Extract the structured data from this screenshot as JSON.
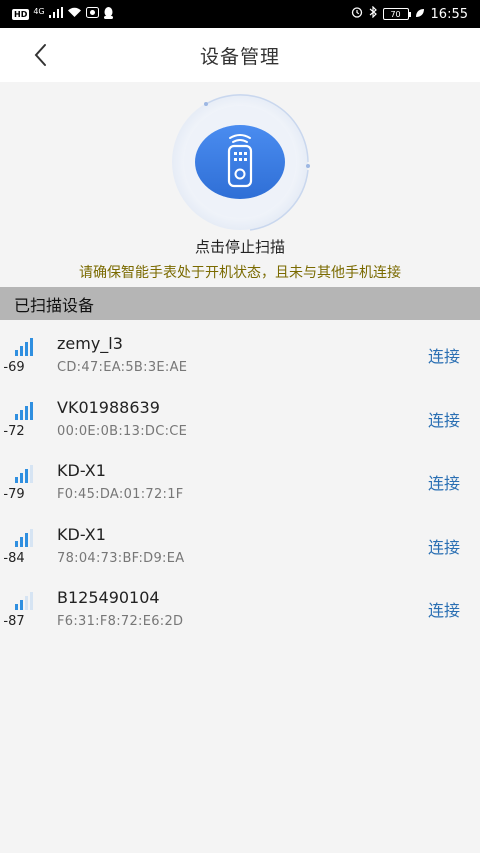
{
  "status_bar": {
    "left_badge": "HD",
    "network": "4G",
    "time": "16:55",
    "battery": "70"
  },
  "navbar": {
    "title": "设备管理"
  },
  "scan": {
    "action_text": "点击停止扫描",
    "warning_text": "请确保智能手表处于开机状态，且未与其他手机连接",
    "icon": "remote-control-icon"
  },
  "section": {
    "title": "已扫描设备"
  },
  "colors": {
    "accent": "#3d7fe0",
    "link": "#2a6fb3",
    "warning": "#7a6a00",
    "signal": "#2f8fe0"
  },
  "devices": [
    {
      "name": "zemy_l3",
      "mac": "CD:47:EA:5B:3E:AE",
      "rssi": "-69",
      "bars": 4,
      "action": "连接"
    },
    {
      "name": "VK01988639",
      "mac": "00:0E:0B:13:DC:CE",
      "rssi": "-72",
      "bars": 4,
      "action": "连接"
    },
    {
      "name": "KD-X1",
      "mac": "F0:45:DA:01:72:1F",
      "rssi": "-79",
      "bars": 3,
      "action": "连接"
    },
    {
      "name": "KD-X1",
      "mac": "78:04:73:BF:D9:EA",
      "rssi": "-84",
      "bars": 3,
      "action": "连接"
    },
    {
      "name": "B125490104",
      "mac": "F6:31:F8:72:E6:2D",
      "rssi": "-87",
      "bars": 2,
      "action": "连接"
    }
  ]
}
